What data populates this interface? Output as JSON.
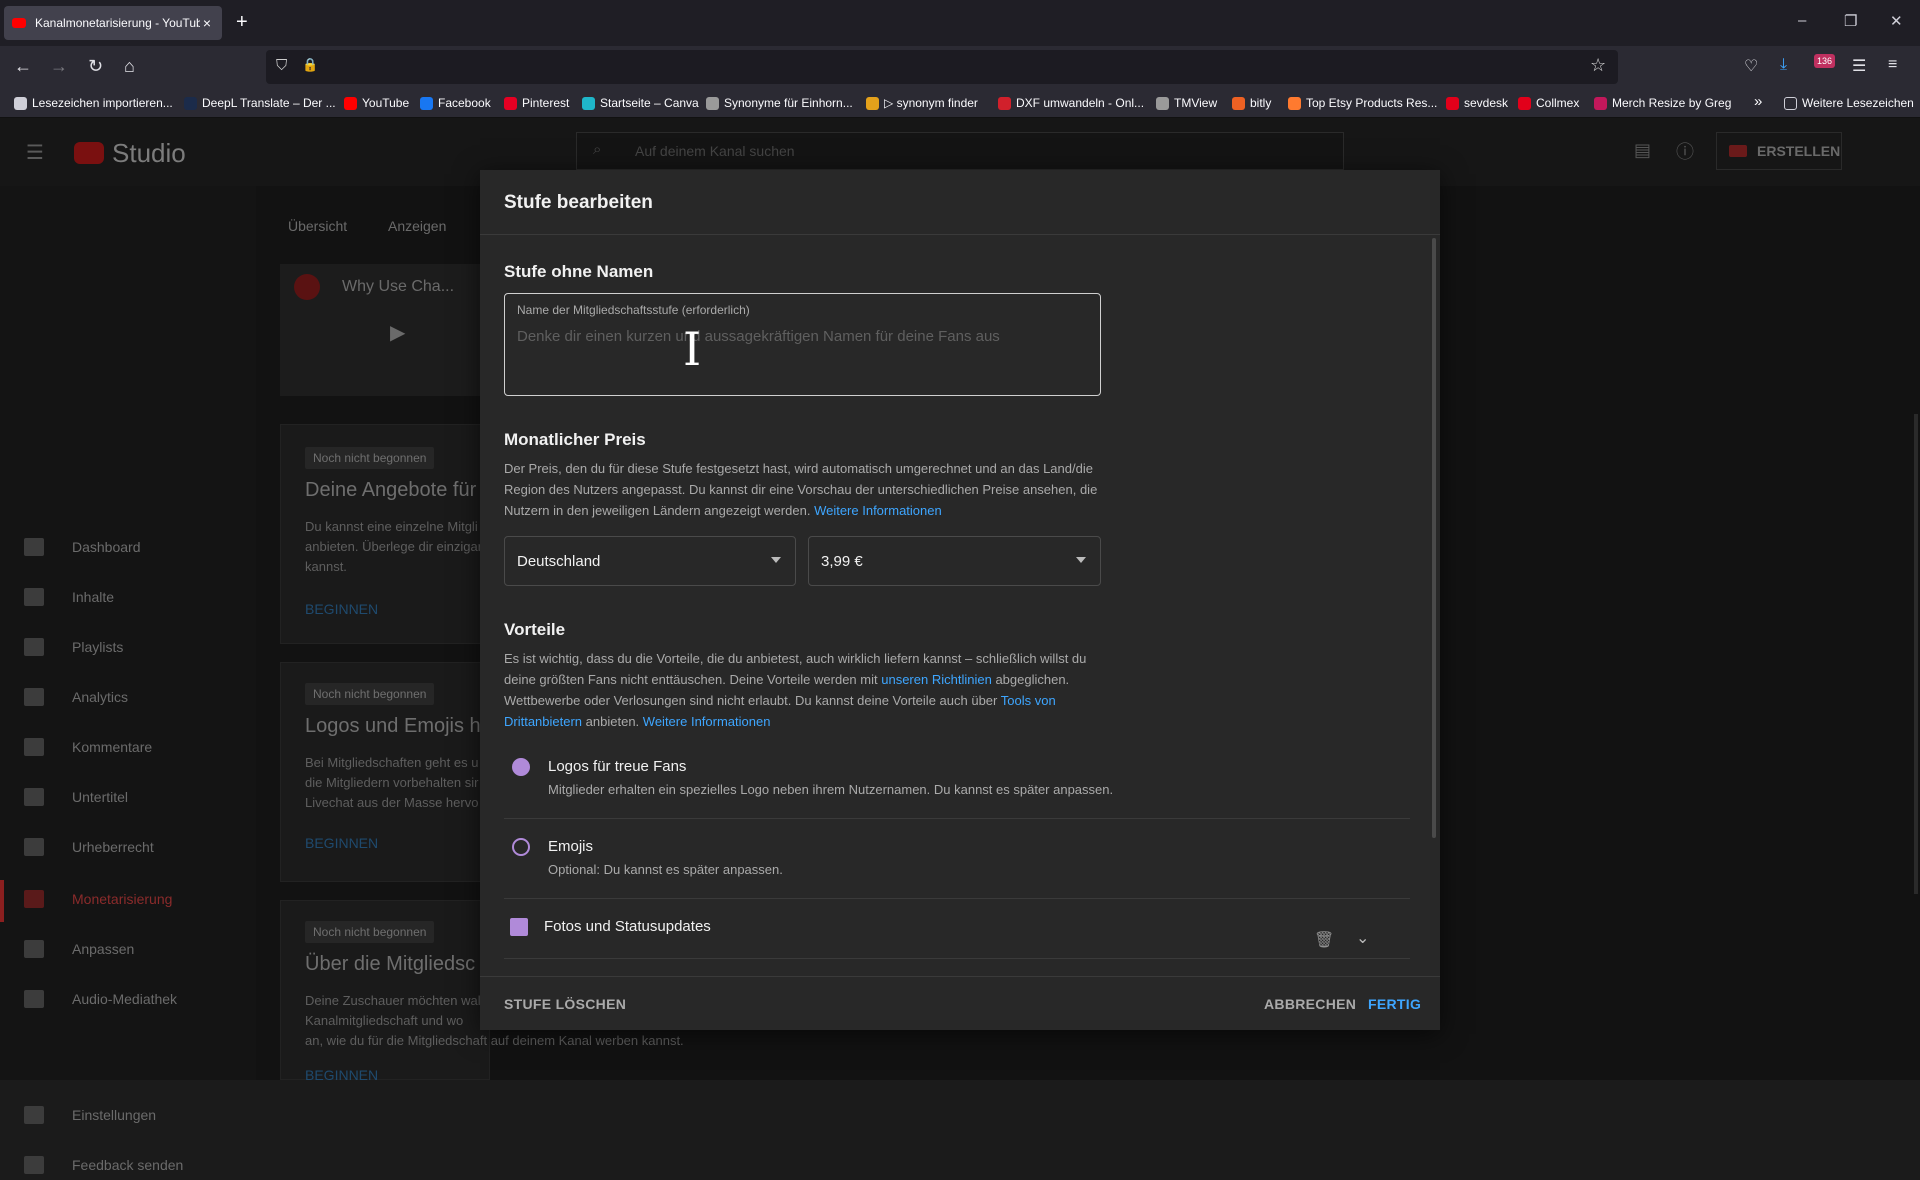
{
  "browser": {
    "tab_title": "Kanalmonetarisierung - YouTube",
    "tab_close": "×",
    "new_tab": "+",
    "window": {
      "minimize": "–",
      "restore": "❐",
      "close": "✕"
    },
    "nav": {
      "back": "←",
      "forward": "→",
      "reload": "↻",
      "home": "⌂",
      "shield": "⛉",
      "lock": "🔒",
      "star": "☆"
    },
    "toolbar": {
      "pocket": "♡",
      "download": "⤓",
      "badge": "136",
      "ext": "☰",
      "menu": "≡"
    },
    "bookmarks": [
      {
        "label": "Lesezeichen importieren...",
        "color": "#cfcfd8"
      },
      {
        "label": "DeepL Translate – Der ...",
        "color": "#1b2b4a"
      },
      {
        "label": "YouTube",
        "color": "#ff0000"
      },
      {
        "label": "Facebook",
        "color": "#1877f2"
      },
      {
        "label": "Pinterest",
        "color": "#e60023"
      },
      {
        "label": "Startseite – Canva",
        "color": "#1fb6c9"
      },
      {
        "label": "Synonyme für Einhorn...",
        "color": "#9a9a9a"
      },
      {
        "label": "▷ synonym finder",
        "color": "#e4a11b"
      },
      {
        "label": "DXF umwandeln - Onl...",
        "color": "#d1202b"
      },
      {
        "label": "TMView",
        "color": "#9a9a9a"
      },
      {
        "label": "bitly",
        "color": "#ee6123"
      },
      {
        "label": "Top Etsy Products Res...",
        "color": "#ff7a2f"
      },
      {
        "label": "sevdesk",
        "color": "#e2001a"
      },
      {
        "label": "Collmex",
        "color": "#e2001a"
      },
      {
        "label": "Merch Resize by Greg",
        "color": "#c2185b"
      }
    ],
    "more_bookmarks": "»",
    "other_bookmarks": "Weitere Lesezeichen"
  },
  "studio": {
    "logo": "Studio",
    "search_placeholder": "Auf deinem Kanal suchen",
    "create_button": "ERSTELLEN",
    "tabs": [
      "Übersicht",
      "Anzeigen"
    ],
    "video_title": "Why Use Cha...",
    "nav": [
      {
        "label": "Dashboard"
      },
      {
        "label": "Inhalte"
      },
      {
        "label": "Playlists"
      },
      {
        "label": "Analytics"
      },
      {
        "label": "Kommentare"
      },
      {
        "label": "Untertitel"
      },
      {
        "label": "Urheberrecht"
      },
      {
        "label": "Monetarisierung"
      },
      {
        "label": "Anpassen"
      },
      {
        "label": "Audio-Mediathek"
      },
      {
        "label": "Einstellungen"
      },
      {
        "label": "Feedback senden"
      }
    ],
    "cards": [
      {
        "badge": "Noch nicht begonnen",
        "title": "Deine Angebote für",
        "text1": "Du kannst eine einzelne Mitgli",
        "text2": "anbieten. Überlege dir einzigar",
        "text3": "kannst.",
        "action": "BEGINNEN"
      },
      {
        "badge": "Noch nicht begonnen",
        "title": "Logos und Emojis h",
        "text1": "Bei Mitgliedschaften geht es u",
        "text2": "die Mitgliedern vorbehalten sir",
        "text3": "Livechat aus der Masse hervo",
        "action": "BEGINNEN"
      },
      {
        "badge": "Noch nicht begonnen",
        "title": "Über die Mitgliedsc",
        "text1": "Deine Zuschauer möchten wal",
        "text2": "Kanalmitgliedschaft und wo",
        "text3": "an, wie du für die Mitgliedschaft auf deinem Kanal werben kannst.",
        "action": "BEGINNEN"
      }
    ]
  },
  "modal": {
    "title": "Stufe bearbeiten",
    "section_name": "Stufe ohne Namen",
    "name_label": "Name der Mitgliedschaftsstufe (erforderlich)",
    "name_placeholder": "Denke dir einen kurzen und aussagekräftigen Namen für deine Fans aus",
    "name_value": "",
    "price_heading": "Monatlicher Preis",
    "price_text": "Der Preis, den du für diese Stufe festgesetzt hast, wird automatisch umgerechnet und an das Land/die Region des Nutzers angepasst. Du kannst dir eine Vorschau der unterschiedlichen Preise ansehen, die Nutzern in den jeweiligen Ländern angezeigt werden.",
    "price_link": "Weitere Informationen",
    "country_value": "Deutschland",
    "price_value": "3,99 €",
    "benefits_heading": "Vorteile",
    "benefits_text_1": "Es ist wichtig, dass du die Vorteile, die du anbietest, auch wirklich liefern kannst – schließlich willst du deine größten Fans nicht enttäuschen. Deine Vorteile werden mit",
    "benefits_link_1": "unseren Richtlinien",
    "benefits_text_2": "abgeglichen. Wettbewerbe oder Verlosungen sind nicht erlaubt. Du kannst deine Vorteile auch über",
    "benefits_link_2": "Tools von Drittanbietern",
    "benefits_text_3": "anbieten.",
    "benefits_link_3": "Weitere Informationen",
    "benefits": [
      {
        "title": "Logos für treue Fans",
        "desc": "Mitglieder erhalten ein spezielles Logo neben ihrem Nutzernamen. Du kannst es später anpassen.",
        "icon": "star-badge-icon"
      },
      {
        "title": "Emojis",
        "desc": "Optional: Du kannst es später anpassen.",
        "icon": "smiley-icon"
      },
      {
        "title": "Fotos und Statusupdates",
        "desc": "",
        "icon": "image-icon"
      }
    ],
    "delete_tier": "STUFE LÖSCHEN",
    "cancel": "ABBRECHEN",
    "done": "FERTIG"
  }
}
